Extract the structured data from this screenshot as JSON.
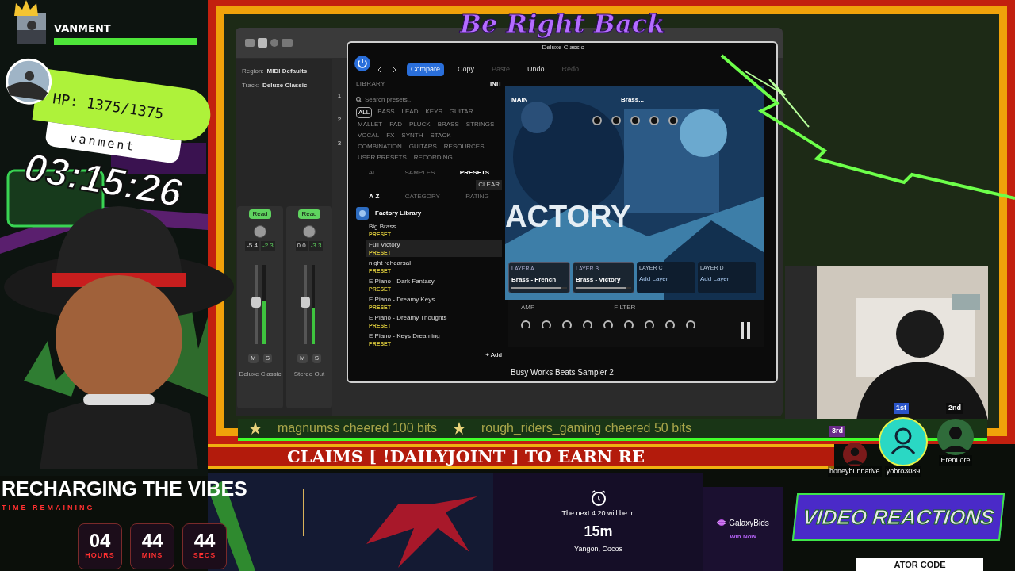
{
  "profile": {
    "banner_name": "VANMENT",
    "hp": "HP: 1375/1375",
    "username": "vanment",
    "hp_bar": {
      "level": 1
    }
  },
  "stream_clock": "03:15:26",
  "brb_title": "Be Right Back",
  "daw": {
    "inspector": [
      {
        "label": "Region:",
        "value": "MIDI Defaults"
      },
      {
        "label": "Track:",
        "value": "Deluxe Classic"
      }
    ],
    "track_numbers": [
      "1",
      "2",
      "3"
    ],
    "mixer": [
      {
        "name": "Deluxe Classic",
        "automation": "Read",
        "readings": [
          "-5.4",
          "-2.3"
        ],
        "meter": {
          "level": 0.55
        },
        "buttons": [
          "M",
          "S"
        ]
      },
      {
        "name": "Stereo Out",
        "automation": "Read",
        "readings": [
          "0.0",
          "-3.3"
        ],
        "meter": {
          "level": 0.45
        },
        "buttons": [
          "M",
          "S"
        ]
      }
    ]
  },
  "plugin": {
    "window_title": "Deluxe Classic",
    "toolbar": [
      {
        "label": "Compare",
        "selected": true,
        "disabled": false
      },
      {
        "label": "Copy",
        "selected": false,
        "disabled": false
      },
      {
        "label": "Paste",
        "selected": false,
        "disabled": true
      },
      {
        "label": "Undo",
        "selected": false,
        "disabled": false
      },
      {
        "label": "Redo",
        "selected": false,
        "disabled": true
      }
    ],
    "library": {
      "title": "LIBRARY",
      "preset": "INIT",
      "search_placeholder": "Search presets...",
      "categories": [
        {
          "label": "ALL",
          "selected": true
        },
        {
          "label": "BASS",
          "selected": false
        },
        {
          "label": "LEAD",
          "selected": false
        },
        {
          "label": "KEYS",
          "selected": false
        },
        {
          "label": "GUITAR",
          "selected": false
        },
        {
          "label": "MALLET",
          "selected": false
        },
        {
          "label": "PAD",
          "selected": false
        },
        {
          "label": "PLUCK",
          "selected": false
        },
        {
          "label": "BRASS",
          "selected": false
        },
        {
          "label": "STRINGS",
          "selected": false
        },
        {
          "label": "VOCAL",
          "selected": false
        },
        {
          "label": "FX",
          "selected": false
        },
        {
          "label": "SYNTH",
          "selected": false
        },
        {
          "label": "STACK",
          "selected": false
        },
        {
          "label": "COMBINATION",
          "selected": false
        },
        {
          "label": "GUITARS",
          "selected": false
        },
        {
          "label": "RESOURCES",
          "selected": false
        },
        {
          "label": "USER PRESETS",
          "selected": false
        },
        {
          "label": "RECORDING",
          "selected": false
        }
      ],
      "source_tabs": [
        {
          "label": "ALL",
          "selected": false
        },
        {
          "label": "SAMPLES",
          "selected": false
        },
        {
          "label": "PRESETS",
          "selected": true
        }
      ],
      "clear": "CLEAR",
      "sort_tabs": [
        {
          "label": "A-Z",
          "selected": true
        },
        {
          "label": "CATEGORY",
          "selected": false
        },
        {
          "label": "RATING",
          "selected": false
        }
      ],
      "folder": "Factory Library",
      "presets": [
        {
          "name": "Big Brass",
          "tag": "PRESET",
          "selected": false
        },
        {
          "name": "Full Victory",
          "tag": "PRESET",
          "selected": true
        },
        {
          "name": "night rehearsal",
          "tag": "PRESET",
          "selected": false
        },
        {
          "name": "E Piano - Dark Fantasy",
          "tag": "PRESET",
          "selected": false
        },
        {
          "name": "E Piano - Dreamy Keys",
          "tag": "PRESET",
          "selected": false
        },
        {
          "name": "E Piano - Dreamy Thoughts",
          "tag": "PRESET",
          "selected": false
        },
        {
          "name": "E Piano - Keys Dreaming",
          "tag": "PRESET",
          "selected": false
        }
      ],
      "add": "+ Add"
    },
    "main": {
      "tabs": [
        {
          "label": "MAIN",
          "selected": true
        }
      ],
      "patch": "Brass...",
      "banner": "ACTORY",
      "layers": [
        {
          "label": "LAYER A",
          "name": "Brass - French",
          "kind": "loaded",
          "slider": {
            "level": 0.9
          }
        },
        {
          "label": "LAYER B",
          "name": "Brass - Victory",
          "kind": "loaded",
          "slider": {
            "level": 0.9
          }
        },
        {
          "label": "LAYER C",
          "name": "Add Layer",
          "kind": "empty"
        },
        {
          "label": "LAYER D",
          "name": "Add Layer",
          "kind": "empty"
        }
      ],
      "sections": [
        "AMP",
        "FILTER"
      ]
    },
    "footer": "Busy Works Beats Sampler 2"
  },
  "ticker": [
    "magnumss cheered 100 bits",
    "rough_riders_gaming cheered 50 bits"
  ],
  "banner": "CLAIMS [ !DAILYJOINT ] TO EARN RE",
  "leaderboard": [
    {
      "rank": "1st",
      "name": "yobro3089"
    },
    {
      "rank": "2nd",
      "name": "ErenLore"
    },
    {
      "rank": "3rd",
      "name": "honeybunnative"
    }
  ],
  "recharge": {
    "title": "RECHARGING THE VIBES",
    "subtitle": "TIME REMAINING",
    "units": [
      {
        "value": "04",
        "label": "HOURS"
      },
      {
        "value": "44",
        "label": "MINS"
      },
      {
        "value": "44",
        "label": "SECS"
      }
    ]
  },
  "four_twenty": {
    "caption": "The next 4:20 will be in",
    "value": "15m",
    "place": "Yangon, Cocos"
  },
  "sponsor": {
    "name": "GalaxyBids",
    "action": "Win Now"
  },
  "video_reactions": "VIDEO REACTIONS",
  "creator_code": "ATOR CODE"
}
